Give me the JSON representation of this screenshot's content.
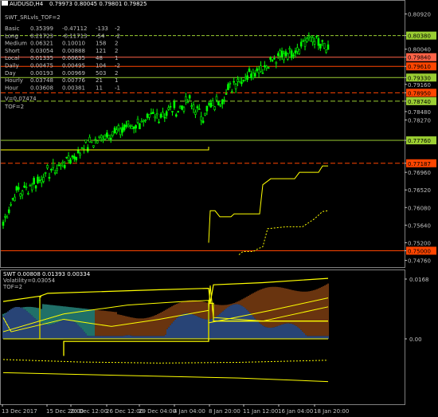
{
  "header": {
    "symbol": "AUDUSD,H4",
    "ohlc": "0.79973 0.80045 0.79801 0.79825",
    "indicator": "SWT_SRLvls_TOF=2"
  },
  "levels_table": [
    {
      "name": "Basic",
      "a": "0.35399",
      "b": "-0.47112",
      "c": "-133",
      "d": "-2"
    },
    {
      "name": "Long",
      "a": "0.21723",
      "b": "-0.11713",
      "c": "-54",
      "d": "-2"
    },
    {
      "name": "Medium",
      "a": "0.06321",
      "b": "0.10010",
      "c": "158",
      "d": "2"
    },
    {
      "name": "Short",
      "a": "0.03054",
      "b": "0.00888",
      "c": "121",
      "d": "2"
    },
    {
      "name": "Local",
      "a": "0.01335",
      "b": "0.00635",
      "c": "48",
      "d": "1"
    },
    {
      "name": "Daily",
      "a": "0.00475",
      "b": "0.00495",
      "c": "104",
      "d": "-2"
    },
    {
      "name": "Day",
      "a": "0.00193",
      "b": "0.00969",
      "c": "503",
      "d": "2"
    },
    {
      "name": "Hourly",
      "a": "0.03748",
      "b": "0.00776",
      "c": "21",
      "d": "1"
    },
    {
      "name": "Hour",
      "a": "0.03608",
      "b": "0.00381",
      "c": "11",
      "d": "-1"
    }
  ],
  "extra_labels": {
    "v_label": "V=0.07474",
    "tof_label": "TOF=2"
  },
  "price_axis": {
    "ticks": [
      "0.80920",
      "0.80380",
      "0.80040",
      "0.79840",
      "0.79610",
      "0.79330",
      "0.79160",
      "0.78950",
      "0.78740",
      "0.78480",
      "0.78270",
      "0.77760",
      "0.77187",
      "0.76960",
      "0.76520",
      "0.76080",
      "0.75640",
      "0.75200",
      "0.75000",
      "0.74760"
    ]
  },
  "tagged_levels": [
    {
      "price": "0.80380",
      "color": "#9acd32"
    },
    {
      "price": "0.79840",
      "color": "#ff6347"
    },
    {
      "price": "0.79610",
      "color": "#ff4500"
    },
    {
      "price": "0.79330",
      "color": "#9acd32"
    },
    {
      "price": "0.78950",
      "color": "#ff4500"
    },
    {
      "price": "0.78740",
      "color": "#9acd32"
    },
    {
      "price": "0.77760",
      "color": "#9acd32"
    },
    {
      "price": "0.77187",
      "color": "#ff4500"
    },
    {
      "price": "0.75000",
      "color": "#ff4500"
    }
  ],
  "sub_window": {
    "header": "SWT 0.00808 0.01393 0.00334",
    "volatility": "Volatility=0.03054",
    "tof": "TOF=2",
    "axis_ticks": [
      "0.0168",
      "0.00"
    ]
  },
  "time_axis": [
    "13 Dec 2017",
    "15 Dec 20:00",
    "20 Dec 12:00",
    "26 Dec 12:00",
    "29 Dec 04:00",
    "4 Jan 04:00",
    "8 Jan 20:00",
    "11 Jan 12:00",
    "16 Jan 04:00",
    "18 Jan 20:00"
  ],
  "colors": {
    "background": "#000000",
    "bull": "#00ff00",
    "bear": "#00ff00",
    "axis": "#c0c0c0",
    "yellow": "#ffff00",
    "lime": "#9acd32",
    "orange_red": "#ff4500",
    "tomato": "#ff6347",
    "sub_blue": "#4472c4",
    "sub_orange": "#d2691e",
    "sub_cyan": "#40e0d0"
  }
}
